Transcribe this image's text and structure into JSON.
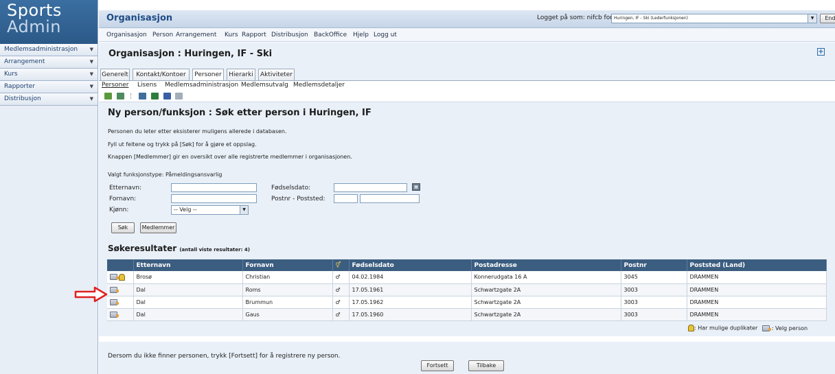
{
  "logo": {
    "line1": "Sports",
    "line2": "Admin"
  },
  "sidebar": {
    "items": [
      {
        "label": "Medlemsadministrasjon"
      },
      {
        "label": "Arrangement"
      },
      {
        "label": "Kurs"
      },
      {
        "label": "Rapporter"
      },
      {
        "label": "Distribusjon"
      }
    ]
  },
  "header": {
    "section_title": "Organisasjon",
    "login_label": "Logget på som: nifcb for",
    "login_value": "Huringen, IF - Ski (Lederfunksjonen)",
    "endre_label": "Endre"
  },
  "menu": [
    "Organisasjon",
    "Person",
    "Arrangement",
    "Kurs",
    "Rapport",
    "Distribusjon",
    "BackOffice",
    "Hjelp",
    "Logg ut"
  ],
  "page": {
    "title": "Organisasjon : Huringen, IF - Ski"
  },
  "tabs": [
    "Generelt",
    "Kontakt/Kontoer",
    "Personer",
    "Hierarki",
    "Aktiviteter"
  ],
  "subtabs": [
    "Personer",
    "Lisens",
    "Medlemsadministrasjon",
    "Medlemsutvalg",
    "Medlemsdetaljer"
  ],
  "search": {
    "heading": "Ny person/funksjon : Søk etter person i Huringen, IF",
    "info1": "Personen du leter etter eksisterer muligens allerede i databasen.",
    "info2": "Fyll ut feltene og trykk på [Søk] for å gjøre et oppslag.",
    "info3": "Knappen [Medlemmer] gir en oversikt over alle registrerte medlemmer i organisasjonen.",
    "funksjonstype": "Valgt funksjonstype: Påmeldingsansvarlig",
    "label_etternavn": "Etternavn:",
    "label_fornavn": "Fornavn:",
    "label_kjonn": "Kjønn:",
    "label_fodselsdato": "Fødselsdato:",
    "label_postnr": "Postnr - Poststed:",
    "kjonn_value": "-- Velg --",
    "sok_button": "Søk",
    "medlemmer_button": "Medlemmer"
  },
  "results": {
    "title": "Søkeresultater",
    "count_text": "(antall viste resultater: 4)",
    "columns": [
      "",
      "Etternavn",
      "Fornavn",
      "",
      "Fødselsdato",
      "Postadresse",
      "Postnr",
      "Poststed (Land)"
    ],
    "rows": [
      {
        "etternavn": "Brosø",
        "fornavn": "Christian",
        "kjonn": "♂",
        "fodselsdato": "04.02.1984",
        "adresse": "Konnerudgata 16 A",
        "postnr": "3045",
        "poststed": "DRAMMEN"
      },
      {
        "etternavn": "Dal",
        "fornavn": "Roms",
        "kjonn": "♂",
        "fodselsdato": "17.05.1961",
        "adresse": "Schwartzgate 2A",
        "postnr": "3003",
        "poststed": "DRAMMEN"
      },
      {
        "etternavn": "Dal",
        "fornavn": "Brummun",
        "kjonn": "♂",
        "fodselsdato": "17.05.1962",
        "adresse": "Schwartzgate 2A",
        "postnr": "3003",
        "poststed": "DRAMMEN"
      },
      {
        "etternavn": "Dal",
        "fornavn": "Gaus",
        "kjonn": "♂",
        "fodselsdato": "17.05.1960",
        "adresse": "Schwartzgate 2A",
        "postnr": "3003",
        "poststed": "DRAMMEN"
      }
    ],
    "legend_dup": ": Har mulige duplikater",
    "legend_select": ": Velg person"
  },
  "footer": {
    "text": "Dersom du ikke finner personen, trykk [Fortsett] for å registrere ny person.",
    "fortsett": "Fortsett",
    "tilbake": "Tilbake"
  },
  "colors": {
    "header_blue": "#1f4c86",
    "table_header": "#3b5d80",
    "arrow": "#e02020"
  }
}
